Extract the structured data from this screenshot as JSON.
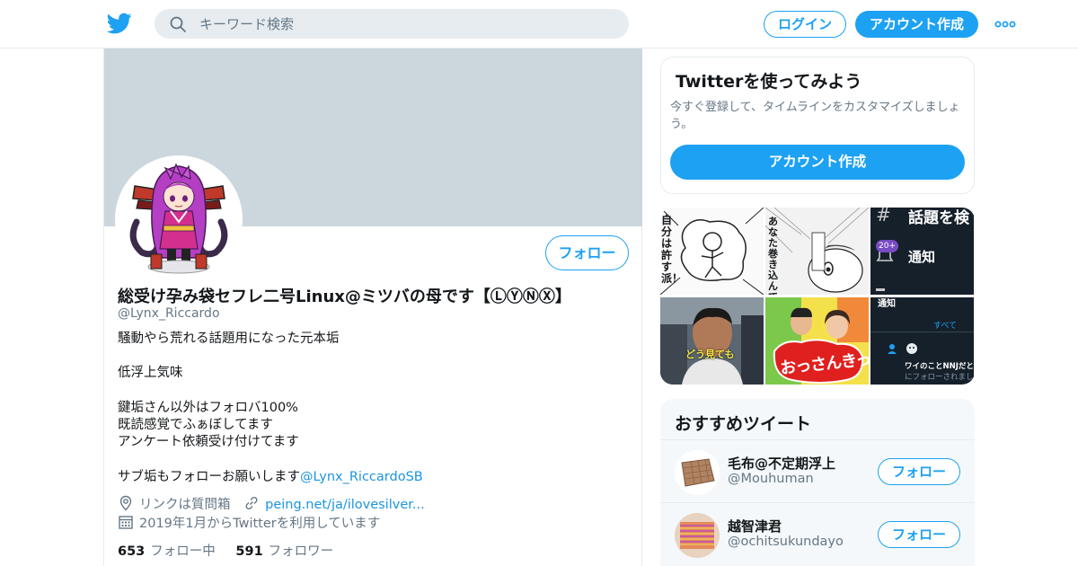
{
  "topbar": {
    "search_placeholder": "キーワード検索",
    "login_label": "ログイン",
    "signup_label": "アカウント作成"
  },
  "profile": {
    "follow_label": "フォロー",
    "display_name": "総受け孕み袋セフレ二号Linux@ミツバの母です【ⓁⓎⓃⓍ】",
    "handle": "@Lynx_Riccardo",
    "bio_lines": [
      "騒動やら荒れる話題用になった元本垢",
      "",
      "低浮上気味",
      "",
      "鍵垢さん以外はフォロバ100%",
      "既読感覚でふぁぼしてます",
      "アンケート依頼受け付けてます",
      "",
      "サブ垢もフォローお願いします"
    ],
    "bio_mention": "@Lynx_RiccardoSB",
    "location": "リンクは質問箱",
    "website": "peing.net/ja/ilovesilver...",
    "joined": "2019年1月からTwitterを利用しています",
    "following_count": "653",
    "following_label": "フォロー中",
    "followers_count": "591",
    "followers_label": "フォロワー"
  },
  "promo": {
    "title": "Twitterを使ってみよう",
    "description": "今すぐ登録して、タイムラインをカスタマイズしましょう。",
    "signup_label": "アカウント作成"
  },
  "media": {
    "tile1_text": "自分は許す派！",
    "tile2_text": "あなた巻き込んでるけど",
    "tile3_text": "話題を検",
    "tile3_badge": "20+",
    "tile3_label": "通知",
    "tile4_text": "どう見ても",
    "tile5_text": "おっさんきっしょ",
    "tile6_header": "通知",
    "tile6_tab": "すべて",
    "tile6_line1": "ワイのことNNJだと思",
    "tile6_line2": "にフォローされまし"
  },
  "recommendations": {
    "title": "おすすめツイート",
    "items": [
      {
        "name": "毛布@不定期浮上",
        "handle": "@Mouhuman",
        "follow_label": "フォロー"
      },
      {
        "name": "越智津君",
        "handle": "@ochitsukundayo",
        "follow_label": "フォロー"
      }
    ]
  },
  "colors": {
    "accent": "#1da1f2",
    "banner": "#ccd6dd",
    "secondary_text": "#657786"
  }
}
